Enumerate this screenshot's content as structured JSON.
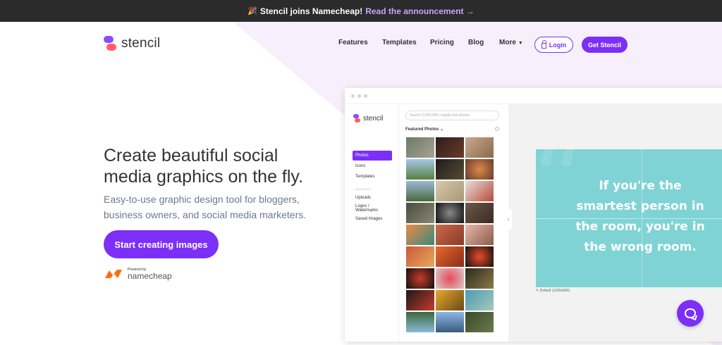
{
  "banner": {
    "icon": "party-popper-icon",
    "text": "Stencil joins Namecheap!",
    "link": "Read the announcement →"
  },
  "nav": {
    "logo_text": "stencil",
    "links": [
      "Features",
      "Templates",
      "Pricing",
      "Blog",
      "More"
    ],
    "login_label": "Login",
    "get_label": "Get Stencil"
  },
  "hero": {
    "title_line1": "Create beautiful social",
    "title_line2": "media graphics on the fly.",
    "sub_line1": "Easy-to-use graphic design tool for bloggers,",
    "sub_line2": "business owners, and social media marketers.",
    "cta_label": "Start creating images",
    "powered_by": "Powered by",
    "namecheap": "namecheap"
  },
  "mockup": {
    "logo_text": "stencil",
    "menu": [
      "Photos",
      "Icons",
      "Templates"
    ],
    "section_label": "ACCOUNT",
    "account_menu": [
      "Uploads",
      "Logos / Watermarks",
      "Saved Images"
    ],
    "search_placeholder": "Search 5,000,000+ royalty-free photos",
    "featured_label": "Featured Photos",
    "quote_line1": "If you're the",
    "quote_line2": "smartest person in",
    "quote_line3": "the room, you're in",
    "quote_line4": "the wrong room.",
    "caption": "Default (1200x800)"
  },
  "colors": {
    "accent": "#7b2ff7",
    "quote_bg": "#7fd3d4",
    "banner_bg": "#2b2b2b"
  }
}
